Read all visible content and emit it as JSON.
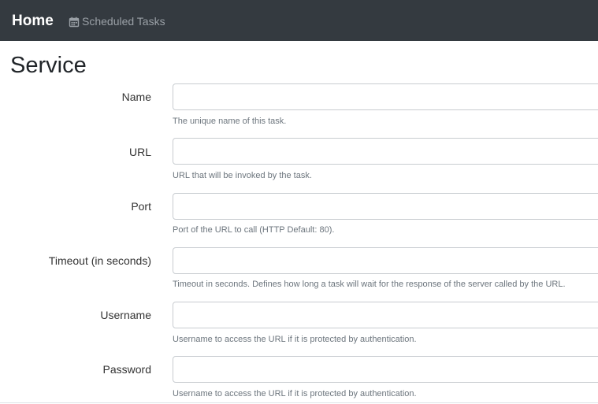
{
  "navbar": {
    "brand": "Home",
    "link_label": "Scheduled Tasks",
    "link_icon": "calendar-icon",
    "background": "#343a40"
  },
  "page": {
    "title": "Service"
  },
  "fields": [
    {
      "label": "Name",
      "value": "",
      "help": "The unique name of this task."
    },
    {
      "label": "URL",
      "value": "",
      "help": "URL that will be invoked by the task."
    },
    {
      "label": "Port",
      "value": "",
      "help": "Port of the URL to call (HTTP Default: 80)."
    },
    {
      "label": "Timeout (in seconds)",
      "value": "",
      "help": "Timeout in seconds. Defines how long a task will wait for the response of the server called by the URL."
    },
    {
      "label": "Username",
      "value": "",
      "help": "Username to access the URL if it is protected by authentication."
    },
    {
      "label": "Password",
      "value": "",
      "help": "Username to access the URL if it is protected by authentication."
    }
  ]
}
